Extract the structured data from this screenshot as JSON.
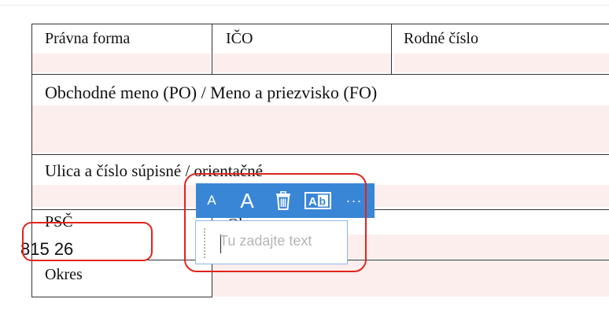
{
  "form": {
    "row1": {
      "pravna_forma": "Právna forma",
      "ico": "IČO",
      "rodne_cislo": "Rodné číslo"
    },
    "row2": {
      "obchodne_meno": "Obchodné meno (PO) / Meno a priezvisko (FO)"
    },
    "row3": {
      "ulica": "Ulica a číslo súpisné / orientačné"
    },
    "row4": {
      "psc_label": "PSČ",
      "psc_value": "815 26",
      "obec_label": "Obec"
    },
    "row5": {
      "okres": "Okres"
    }
  },
  "toolbar": {
    "decrease_font": "A",
    "increase_font": "A",
    "more": "···"
  },
  "textbox": {
    "placeholder": "Tu zadajte text"
  },
  "colors": {
    "toolbar_blue": "#3a86d6",
    "highlight_red": "#e2231a",
    "field_pink": "#fdeeee"
  }
}
